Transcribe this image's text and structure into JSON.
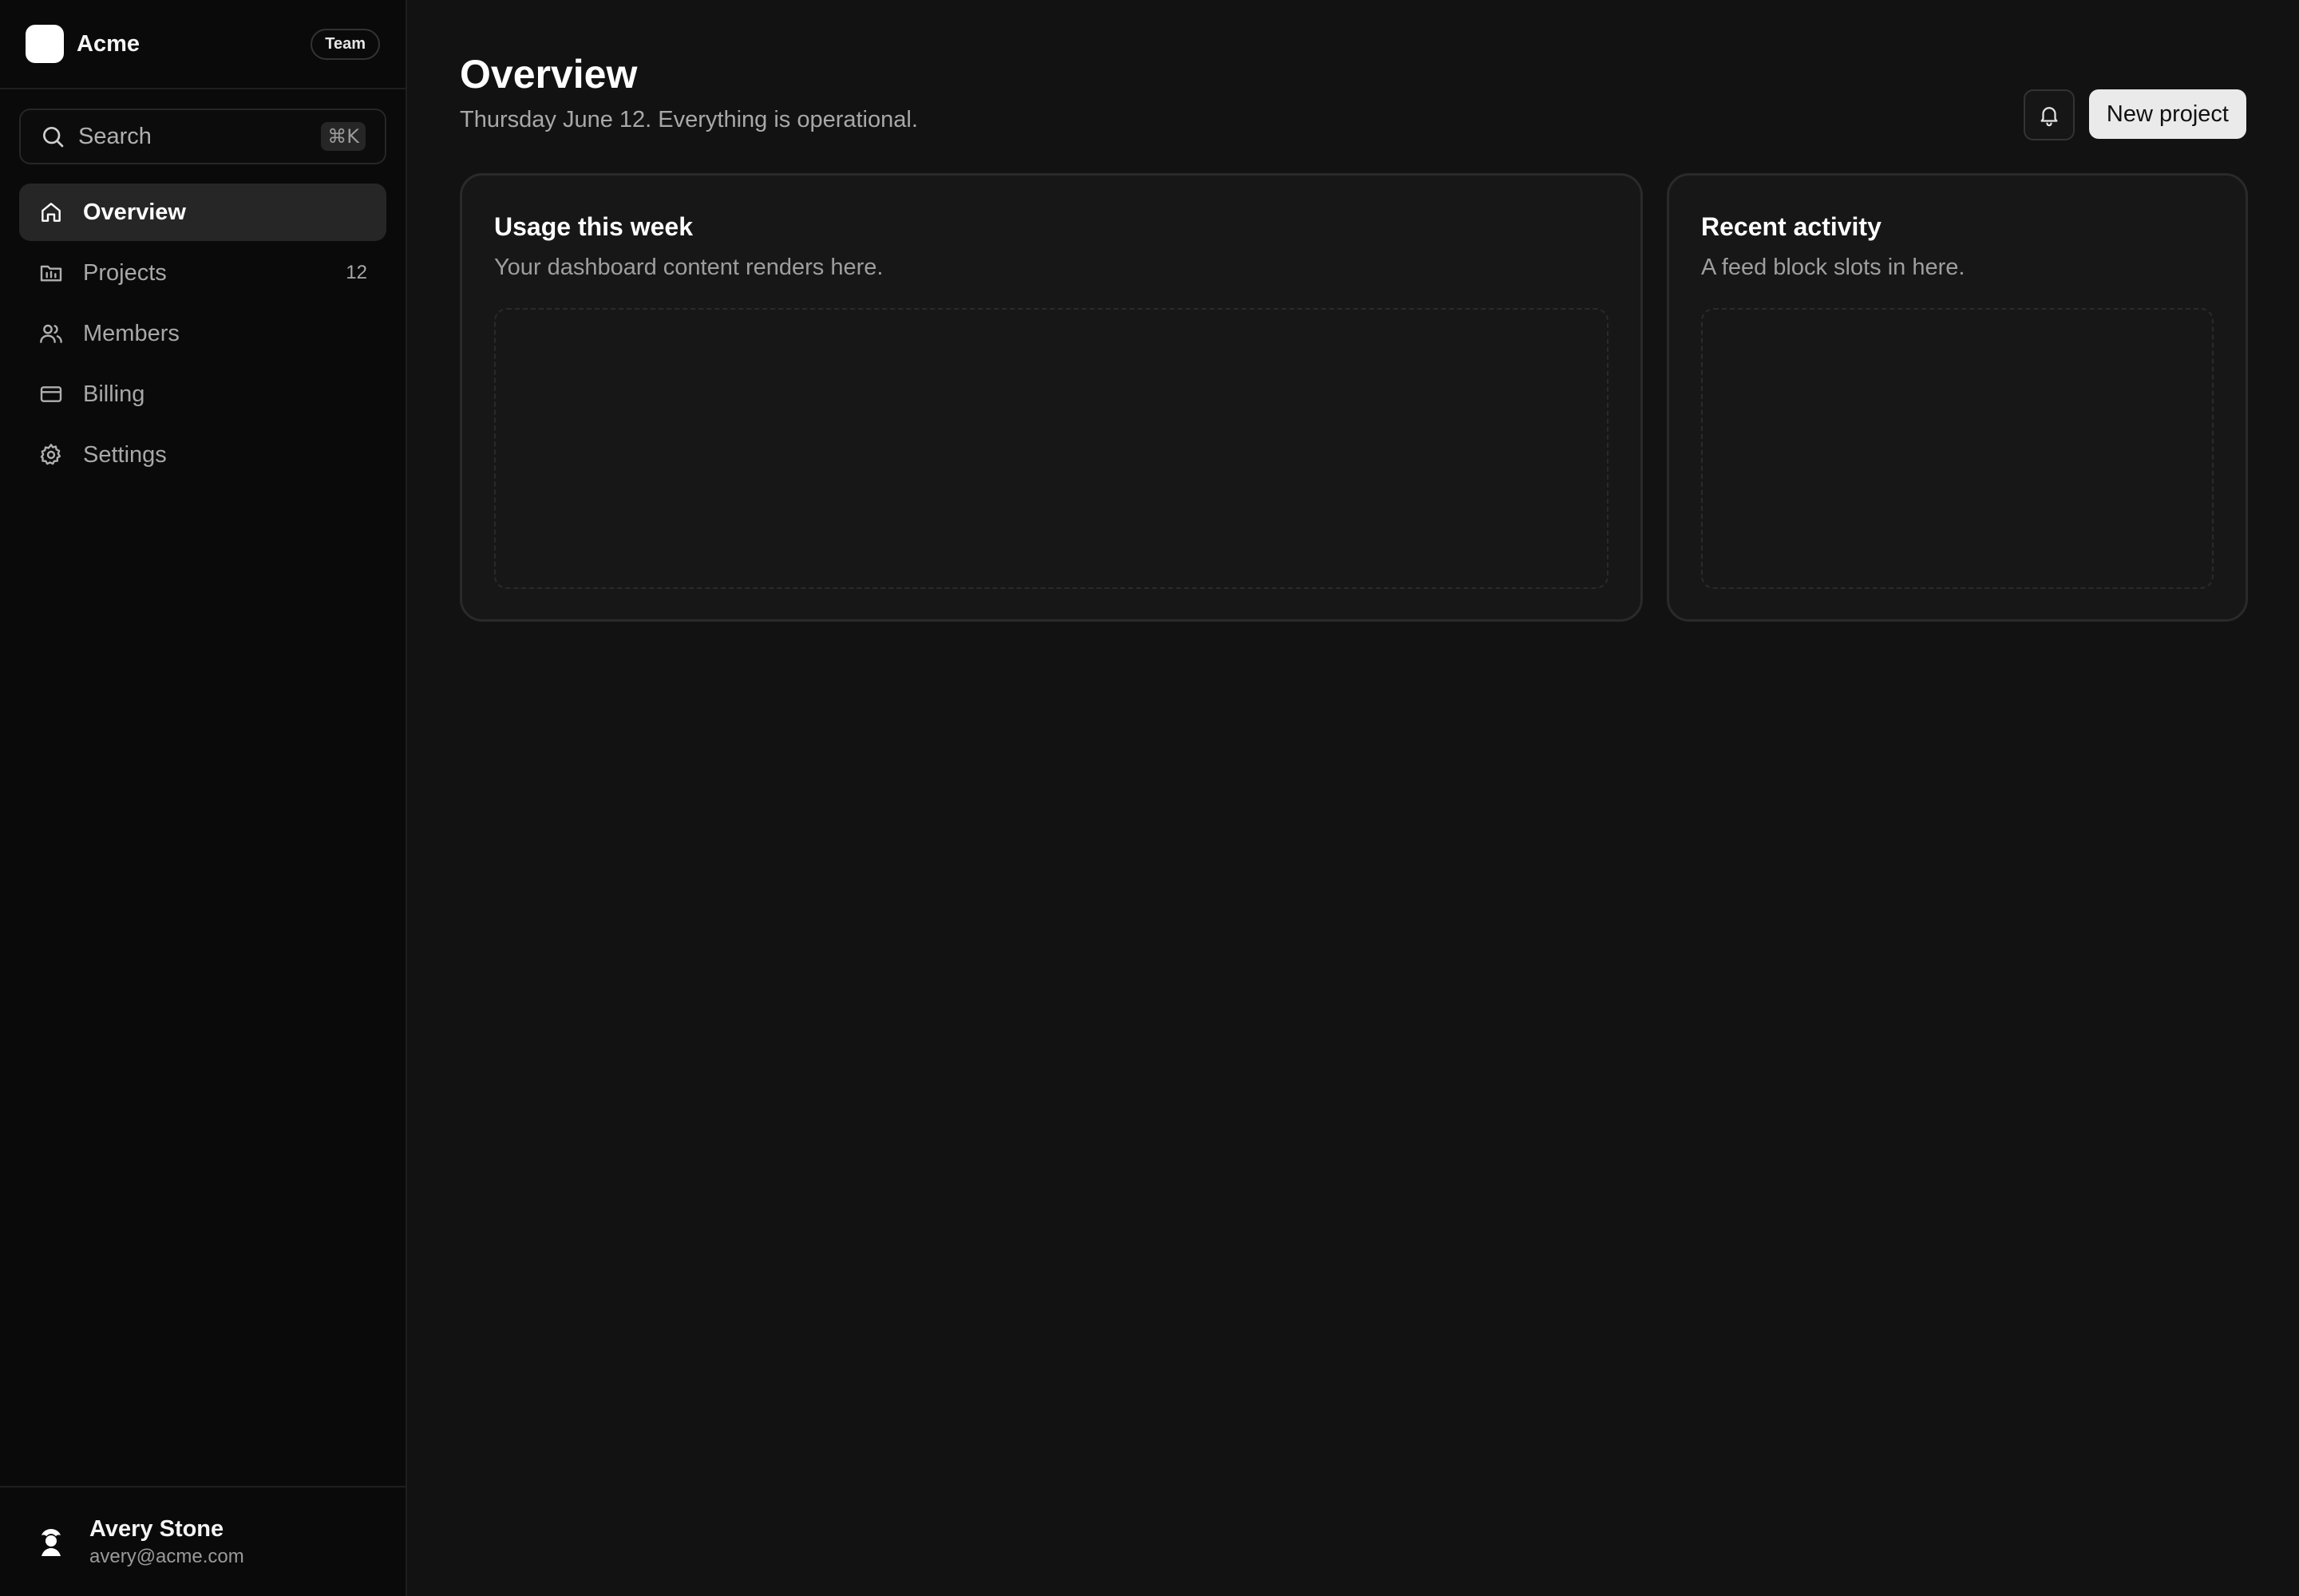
{
  "brand": {
    "name": "Acme",
    "badge": "Team"
  },
  "search": {
    "label": "Search",
    "shortcut": "⌘K"
  },
  "sidebar": {
    "items": [
      {
        "label": "Overview",
        "icon": "home-icon",
        "active": true
      },
      {
        "label": "Projects",
        "icon": "folder-chart-icon",
        "count": "12"
      },
      {
        "label": "Members",
        "icon": "users-icon"
      },
      {
        "label": "Billing",
        "icon": "credit-card-icon"
      },
      {
        "label": "Settings",
        "icon": "gear-icon"
      }
    ]
  },
  "user": {
    "name": "Avery Stone",
    "email": "avery@acme.com"
  },
  "header": {
    "title": "Overview",
    "subtitle": "Thursday June 12. Everything is operational.",
    "primary_button": "New project"
  },
  "cards": [
    {
      "title": "Usage this week",
      "description": "Your dashboard content renders here."
    },
    {
      "title": "Recent activity",
      "description": "A feed block slots in here."
    }
  ]
}
